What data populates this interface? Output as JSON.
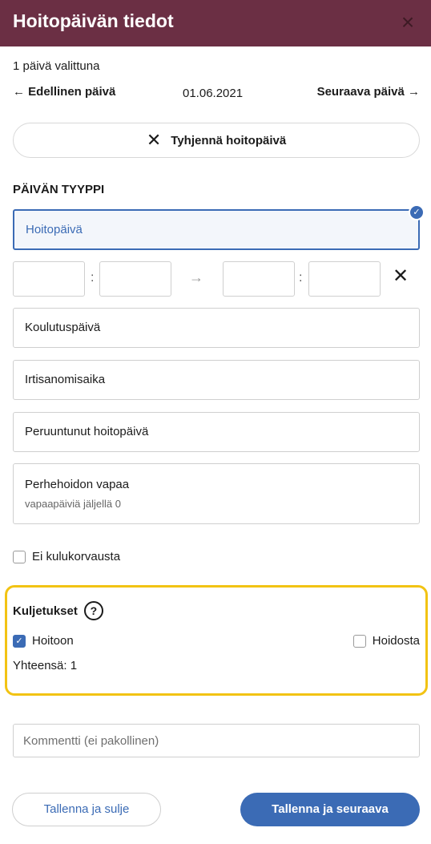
{
  "header": {
    "title": "Hoitopäivän tiedot",
    "close_icon": "×"
  },
  "selection": {
    "count_text": "1 päivä valittuna"
  },
  "nav": {
    "prev": "← Edellinen päivä",
    "date": "01.06.2021",
    "next": "Seuraava päivä →"
  },
  "clear": {
    "icon": "✕",
    "label": "Tyhjennä hoitopäivä"
  },
  "day_type": {
    "label": "PÄIVÄN TYYPPI",
    "options": [
      {
        "label": "Hoitopäivä",
        "selected": true
      },
      {
        "label": "Koulutuspäivä"
      },
      {
        "label": "Irtisanomisaika"
      },
      {
        "label": "Peruuntunut hoitopäivä"
      },
      {
        "label": "Perhehoidon vapaa",
        "sub": "vapaapäiviä jäljellä 0"
      }
    ]
  },
  "time": {
    "separator": ":",
    "arrow": "→",
    "clear_icon": "✕"
  },
  "no_cost": {
    "label": "Ei kulukorvausta",
    "checked": false
  },
  "transport": {
    "title": "Kuljetukset",
    "help_icon": "?",
    "to_care": {
      "label": "Hoitoon",
      "checked": true
    },
    "from_care": {
      "label": "Hoidosta",
      "checked": false
    },
    "total": "Yhteensä: 1"
  },
  "comment": {
    "placeholder": "Kommentti (ei pakollinen)"
  },
  "buttons": {
    "save_close": "Tallenna ja sulje",
    "save_next": "Tallenna ja seuraava"
  },
  "colors": {
    "header": "#6b2f44",
    "accent": "#3b6bb5",
    "highlight": "#f2c313"
  }
}
